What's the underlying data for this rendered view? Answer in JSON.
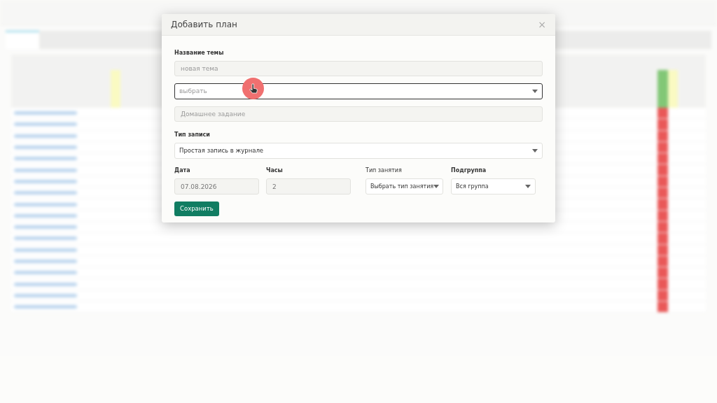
{
  "dialog": {
    "title": "Добавить план",
    "close": "×",
    "topic": {
      "label": "Название темы",
      "placeholder": "новая тема"
    },
    "topic_select": {
      "placeholder": "выбрать",
      "focused": true
    },
    "homework": {
      "placeholder": "Домашнее задание"
    },
    "record_type": {
      "label": "Тип записи",
      "value": "Простая запись в журнале"
    },
    "fields": [
      {
        "label": "Дата",
        "bold": true,
        "kind": "input",
        "value": "07.08.2026"
      },
      {
        "label": "Часы",
        "bold": true,
        "kind": "input",
        "value": "2"
      },
      {
        "label": "Тип занятия",
        "bold": false,
        "kind": "select",
        "value": "Выбрать тип занятия"
      },
      {
        "label": "Подгруппа",
        "bold": true,
        "kind": "select",
        "value": "Вся группа"
      }
    ],
    "save": "Сохранить"
  }
}
